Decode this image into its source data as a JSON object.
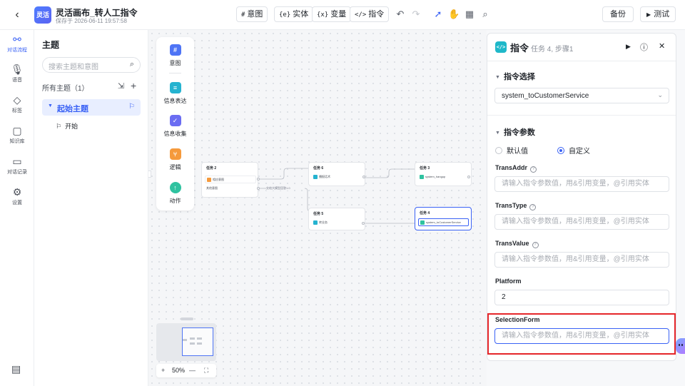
{
  "header": {
    "back": "‹",
    "logo_text": "灵活",
    "title": "灵活画布_转人工指令",
    "saved": "保存于 2026-06-11 19:57:58",
    "tools": {
      "intent": "意图",
      "entity": "实体",
      "variable": "变量",
      "instruction": "指令"
    },
    "tool_icons": {
      "intent": "#",
      "entity": "{e}",
      "variable": "{x}",
      "instruction": "</>"
    },
    "backup": "备份",
    "test": "测试"
  },
  "leftnav": {
    "items": [
      {
        "label": "对话流程",
        "icon": "flow-icon"
      },
      {
        "label": "语音",
        "icon": "microphone-icon"
      },
      {
        "label": "标签",
        "icon": "tag-icon"
      },
      {
        "label": "知识库",
        "icon": "book-icon"
      },
      {
        "label": "对话记录",
        "icon": "chat-icon"
      },
      {
        "label": "设置",
        "icon": "gear-icon"
      }
    ]
  },
  "topics": {
    "title": "主题",
    "search_placeholder": "搜索主题和意图",
    "all_label": "所有主题（1）",
    "topic": "起始主题",
    "sub": "开始"
  },
  "palette": {
    "items": [
      "意图",
      "信息表达",
      "信息收集",
      "逻辑",
      "动作"
    ]
  },
  "canvas": {
    "nodes": {
      "task2": {
        "title": "任务 2",
        "rows": [
          "相应意图",
          "其他意图"
        ]
      },
      "task6": {
        "title": "任务 6",
        "rows": [
          "播报话术"
        ]
      },
      "task3": {
        "title": "任务 3",
        "rows": [
          "system_hangup"
        ]
      },
      "task5": {
        "title": "任务 5",
        "rows": [
          "转业务"
        ]
      },
      "task4": {
        "title": "任务 4",
        "rows": [
          "system_toCustomerService"
        ]
      }
    },
    "edge_label": "交给大模型回答1.0",
    "zoom": "50%"
  },
  "panel": {
    "title": "指令",
    "subtitle": "任务 4, 步骤1",
    "selection_title": "指令选择",
    "selected_instruction": "system_toCustomerService",
    "params_title": "指令参数",
    "radio_default": "默认值",
    "radio_custom": "自定义",
    "radio_selected": "custom",
    "placeholder": "请输入指令参数值，用&引用变量，@引用实体",
    "fields": [
      {
        "label": "TransAddr",
        "help": true,
        "value": ""
      },
      {
        "label": "TransType",
        "help": true,
        "value": ""
      },
      {
        "label": "TransValue",
        "help": true,
        "value": ""
      },
      {
        "label": "Platform",
        "help": false,
        "value": "2"
      },
      {
        "label": "SelectionForm",
        "help": false,
        "value": ""
      }
    ]
  },
  "colors": {
    "accent": "#3a62f5",
    "highlight": "#e5262a",
    "instruction_icon": "#1fb8c9"
  }
}
